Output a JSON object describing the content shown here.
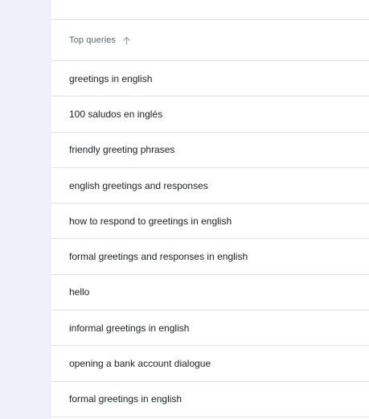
{
  "table": {
    "header": {
      "label": "Top queries",
      "sort_icon": "arrow-up-icon"
    },
    "rows": [
      "greetings in english",
      "100 saludos en inglés",
      "friendly greeting phrases",
      "english greetings and responses",
      "how to respond to greetings in english",
      "formal greetings and responses in english",
      "hello",
      "informal greetings in english",
      "opening a bank account dialogue",
      "formal greetings in english"
    ]
  }
}
